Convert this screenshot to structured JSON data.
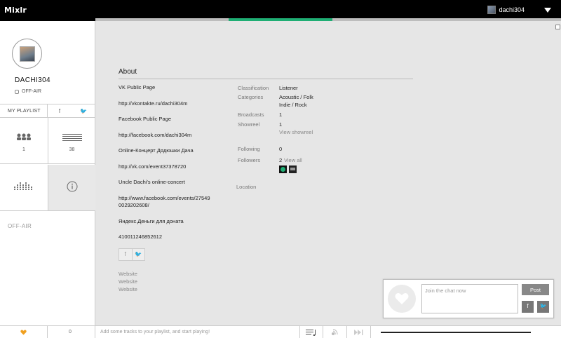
{
  "app": {
    "logo": "Mixlr"
  },
  "user_menu": {
    "username": "dachi304"
  },
  "profile": {
    "name": "DACHI304",
    "status": "OFF-AIR"
  },
  "playlist_bar": {
    "label": "MY PLAYLIST",
    "facebook_icon": "f",
    "twitter_icon": "🐦"
  },
  "stats": {
    "followers_count": "1",
    "following_count": "38"
  },
  "sidebar_status": "OFF-AIR",
  "about": {
    "title": "About",
    "links": [
      "VK Public Page",
      "http://vkontakte.ru/dachi304m",
      "Facebook Public Page",
      "http://facebook.com/dachi304m",
      "Online-Концерт Дядюшки Дача",
      "http://vk.com/event37378720",
      "Uncle Dachi's online-concert",
      "http://www.facebook.com/events/27549",
      "0029202608/",
      "Яндекс.Деньги для доната",
      "410011246852612"
    ],
    "websites": [
      "Website",
      "Website",
      "Website"
    ]
  },
  "details": {
    "classification_key": "Classification",
    "classification_val": "Listener",
    "categories_key": "Categories",
    "categories_val1": "Acoustic / Folk",
    "categories_val2": "Indie / Rock",
    "broadcasts_key": "Broadcasts",
    "broadcasts_val": "1",
    "showreel_key": "Showreel",
    "showreel_val": "1",
    "showreel_link": "View showreel",
    "following_key": "Following",
    "following_val": "0",
    "followers_key": "Followers",
    "followers_val": "2",
    "followers_link": "View all",
    "location_key": "Location"
  },
  "chat": {
    "placeholder": "Join the chat now",
    "post_label": "Post",
    "fb_label": "f",
    "tw_label": "🐦"
  },
  "bottom": {
    "count": "0",
    "hint": "Add some tracks to your playlist, and start playing!"
  },
  "colors": {
    "accent": "#1fae74",
    "topbar": "#000000"
  }
}
